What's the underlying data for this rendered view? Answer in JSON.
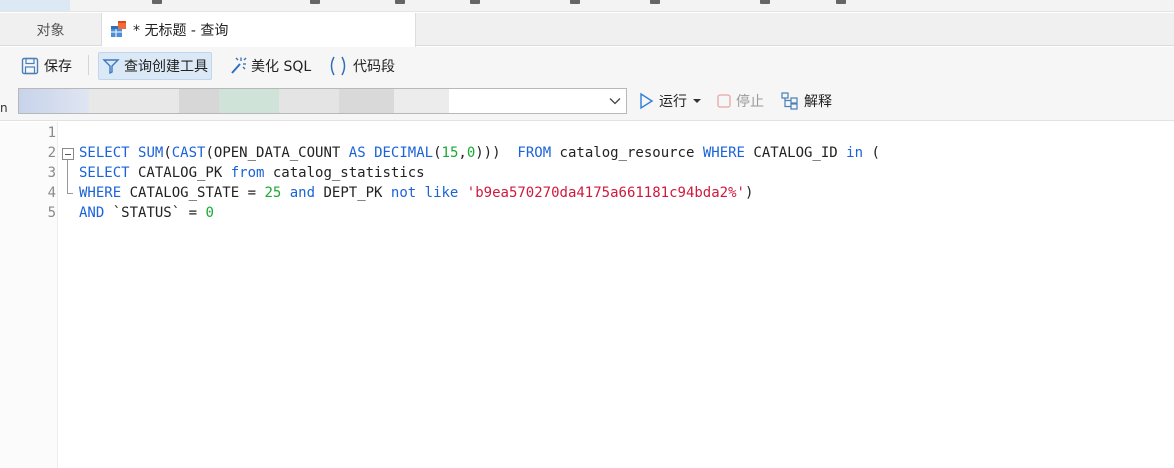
{
  "tabs": {
    "objects_label": "对象",
    "query_label": "* 无标题 - 查询"
  },
  "toolbar": {
    "save_label": "保存",
    "query_builder_label": "查询创建工具",
    "beautify_label": "美化 SQL",
    "snippet_label": "代码段",
    "run_label": "运行",
    "stop_label": "停止",
    "explain_label": "解释"
  },
  "left_edge_text": "ni",
  "editor": {
    "line_numbers": [
      "1",
      "2",
      "3",
      "4",
      "5"
    ],
    "lines": [
      [],
      [
        {
          "t": "SELECT",
          "c": "kw"
        },
        {
          "t": " ",
          "c": ""
        },
        {
          "t": "SUM",
          "c": "fn"
        },
        {
          "t": "(",
          "c": ""
        },
        {
          "t": "CAST",
          "c": "fn"
        },
        {
          "t": "(OPEN_DATA_COUNT ",
          "c": ""
        },
        {
          "t": "AS",
          "c": "kw"
        },
        {
          "t": " ",
          "c": ""
        },
        {
          "t": "DECIMAL",
          "c": "kw"
        },
        {
          "t": "(",
          "c": ""
        },
        {
          "t": "15",
          "c": "num"
        },
        {
          "t": ",",
          "c": ""
        },
        {
          "t": "0",
          "c": "num"
        },
        {
          "t": ")))  ",
          "c": ""
        },
        {
          "t": "FROM",
          "c": "kw"
        },
        {
          "t": " catalog_resource ",
          "c": ""
        },
        {
          "t": "WHERE",
          "c": "kw"
        },
        {
          "t": " CATALOG_ID ",
          "c": ""
        },
        {
          "t": "in",
          "c": "kw"
        },
        {
          "t": " (",
          "c": ""
        }
      ],
      [
        {
          "t": "SELECT",
          "c": "kw"
        },
        {
          "t": " CATALOG_PK ",
          "c": ""
        },
        {
          "t": "from",
          "c": "kw"
        },
        {
          "t": " catalog_statistics",
          "c": ""
        }
      ],
      [
        {
          "t": "WHERE",
          "c": "kw"
        },
        {
          "t": " CATALOG_STATE = ",
          "c": ""
        },
        {
          "t": "25",
          "c": "num"
        },
        {
          "t": " ",
          "c": ""
        },
        {
          "t": "and",
          "c": "kw"
        },
        {
          "t": " DEPT_PK ",
          "c": ""
        },
        {
          "t": "not",
          "c": "kw"
        },
        {
          "t": " ",
          "c": ""
        },
        {
          "t": "like",
          "c": "kw"
        },
        {
          "t": " ",
          "c": ""
        },
        {
          "t": "'b9ea570270da4175a661181c94bda2%'",
          "c": "str"
        },
        {
          "t": ")",
          "c": ""
        }
      ],
      [
        {
          "t": "AND",
          "c": "kw"
        },
        {
          "t": " `STATUS` = ",
          "c": ""
        },
        {
          "t": "0",
          "c": "num"
        }
      ]
    ]
  },
  "colors": {
    "keyword": "#1a63d8",
    "number": "#19a832",
    "string": "#d0183c"
  }
}
